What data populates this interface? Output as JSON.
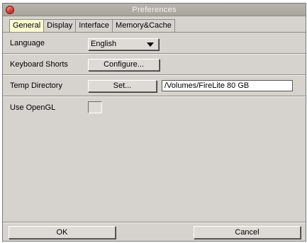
{
  "window": {
    "title": "Preferences"
  },
  "tabs": [
    {
      "label": "General",
      "active": true
    },
    {
      "label": "Display",
      "active": false
    },
    {
      "label": "Interface",
      "active": false
    },
    {
      "label": "Memory&Cache",
      "active": false
    }
  ],
  "settings": {
    "language": {
      "label": "Language",
      "selected": "English"
    },
    "keyboard_shortcuts": {
      "label": "Keyboard Shorts",
      "button_label": "Configure..."
    },
    "temp_directory": {
      "label": "Temp Directory",
      "button_label": "Set...",
      "path": "/Volumes/FireLite 80 GB"
    },
    "use_opengl": {
      "label": "Use OpenGL",
      "checked": false
    }
  },
  "footer": {
    "ok_label": "OK",
    "cancel_label": "Cancel"
  },
  "icons": {
    "close": "close-icon",
    "dropdown": "chevron-down-icon"
  },
  "colors": {
    "window_bg": "#d6d3ce",
    "active_tab": "#fbfbcf",
    "close_button": "#d6362a"
  }
}
